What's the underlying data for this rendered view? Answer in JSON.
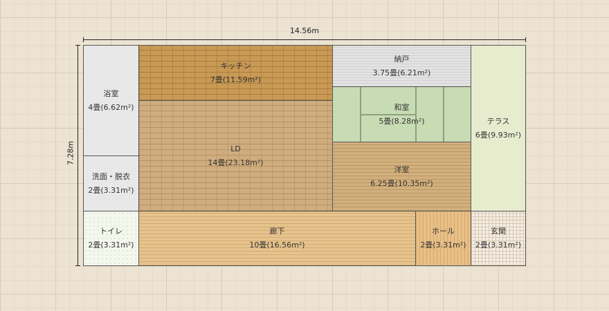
{
  "dimensions": {
    "width": "14.56m",
    "height": "7.28m"
  },
  "rooms": {
    "bath": {
      "name": "浴室",
      "area": "4畳(6.62m²)"
    },
    "kitchen": {
      "name": "キッチン",
      "area": "7畳(11.59m²)"
    },
    "storage": {
      "name": "納戸",
      "area": "3.75畳(6.21m²)"
    },
    "terrace": {
      "name": "テラス",
      "area": "6畳(9.93m²)"
    },
    "washitsu": {
      "name": "和室",
      "area": "5畳(8.28m²)"
    },
    "ld": {
      "name": "LD",
      "area": "14畳(23.18m²)"
    },
    "washroom": {
      "name": "洗面・脱衣",
      "area": "2畳(3.31m²)"
    },
    "youshitsu": {
      "name": "洋室",
      "area": "6.25畳(10.35m²)"
    },
    "toilet": {
      "name": "トイレ",
      "area": "2畳(3.31m²)"
    },
    "corridor": {
      "name": "廊下",
      "area": "10畳(16.56m²)"
    },
    "hall": {
      "name": "ホール",
      "area": "2畳(3.31m²)"
    },
    "entrance": {
      "name": "玄関",
      "area": "2畳(3.31m²)"
    }
  }
}
